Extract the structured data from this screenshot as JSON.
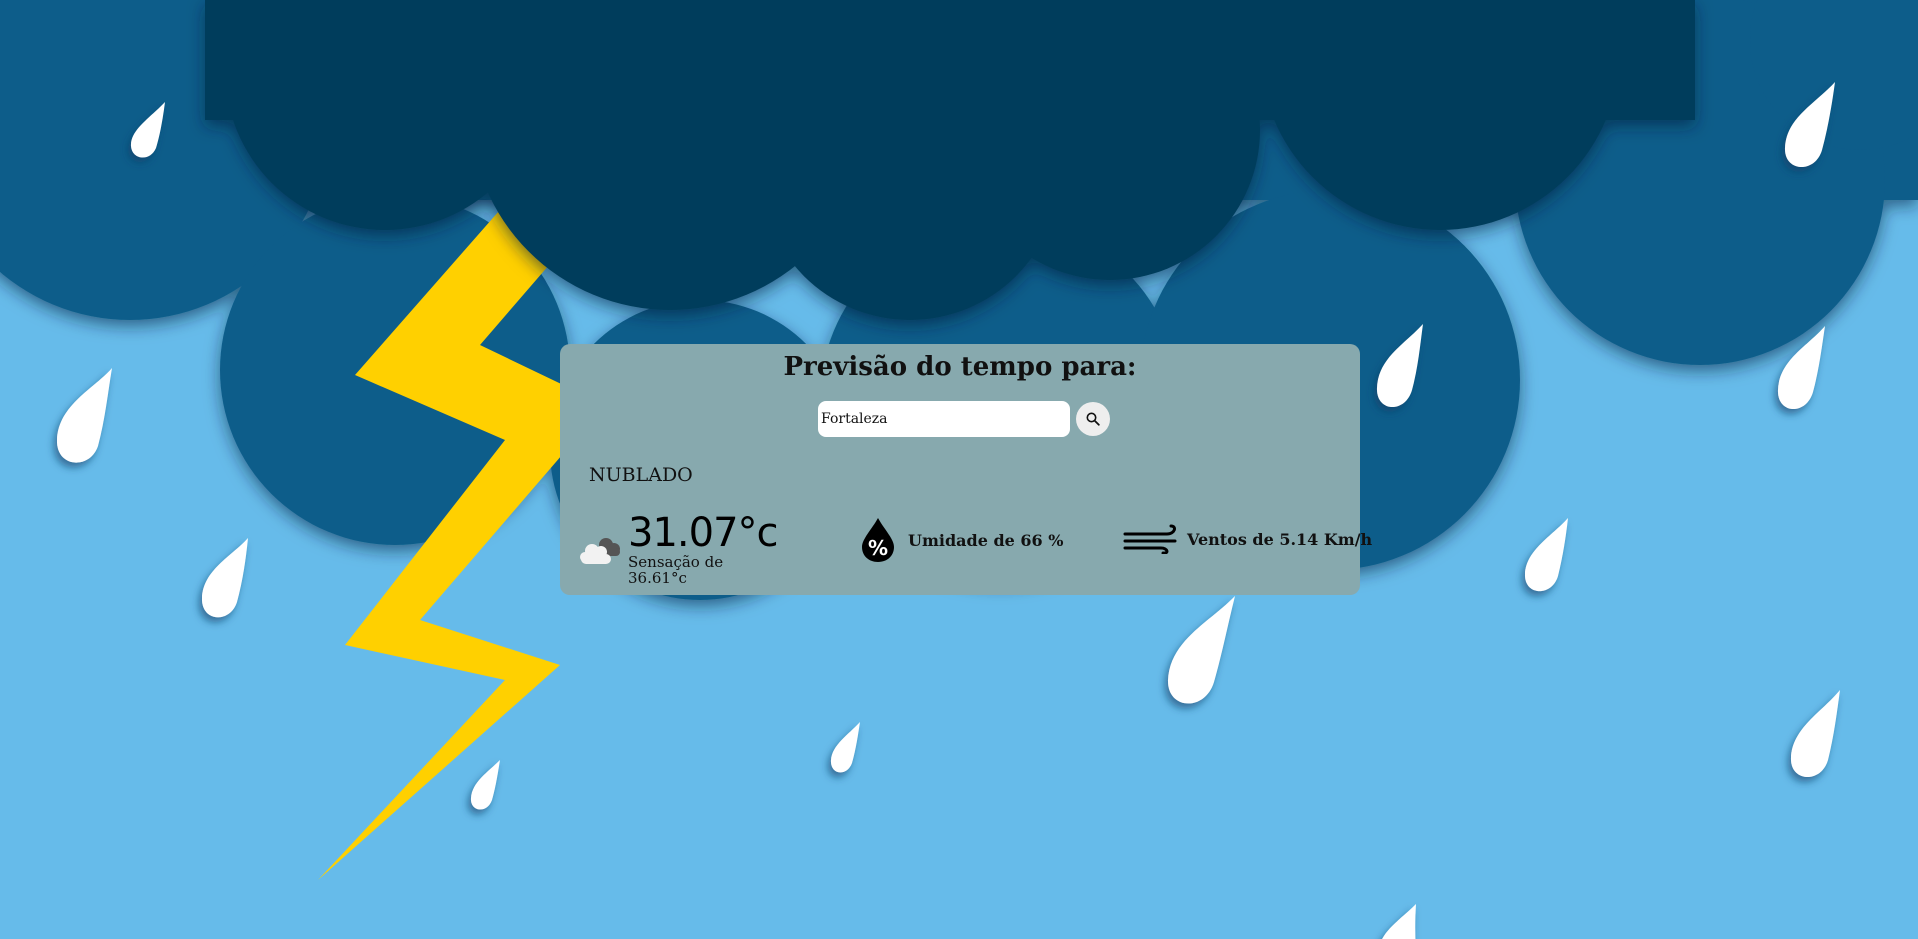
{
  "header": {
    "title": "Previsão do tempo para:"
  },
  "search": {
    "value": "Fortaleza",
    "button_icon": "search-icon"
  },
  "weather": {
    "condition": "NUBLADO",
    "condition_icon": "cloudy-icon",
    "temperature": "31.07°c",
    "feels_like_label": "Sensação de",
    "feels_like_value": "36.61°c",
    "humidity_icon": "humidity-drop-icon",
    "humidity_text": "Umidade de 66 %",
    "wind_icon": "wind-icon",
    "wind_text": "Ventos de 5.14 Km/h"
  },
  "colors": {
    "sky": "#66bbea",
    "cloud_dark": "#003d5c",
    "cloud_mid": "#0b5d8a",
    "lightning": "#ffd000",
    "card": "#87a9ae"
  }
}
